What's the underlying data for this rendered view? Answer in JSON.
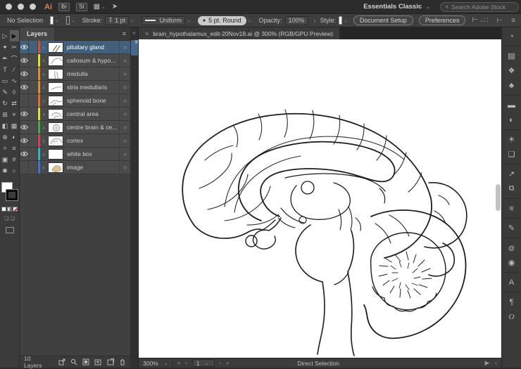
{
  "ui": {
    "logo_color": "#dd8454",
    "selection_color": "#41607c"
  },
  "titlebar": {
    "logo": "Ai",
    "bridge_button": "Br",
    "stock_button": "St",
    "workspace": "Essentials Classic",
    "search_placeholder": "Search Adobe Stock"
  },
  "controls": {
    "no_selection": "No Selection",
    "stroke_label": "Stroke:",
    "stroke_value": "1 pt",
    "width_profile": "Uniform",
    "brush_dot": "●",
    "brush": "5 pt. Round",
    "opacity_label": "Opacity:",
    "opacity_value": "100%",
    "more_separator": "›",
    "style_label": "Style:",
    "document_setup": "Document Setup",
    "preferences": "Preferences"
  },
  "doc_tab": {
    "close": "×",
    "title": "brain_hypothalamus_edit-20Nov18.ai @ 300% (RGB/GPU Preview)"
  },
  "layers": {
    "title": "Layers",
    "footer_count": "10 Layers",
    "items": [
      {
        "name": "pituitary gland",
        "color": "#d6512f"
      },
      {
        "name": "callosum & hypo...",
        "color": "#e3df33"
      },
      {
        "name": "medulla",
        "color": "#e08f2e"
      },
      {
        "name": "stria medullaris",
        "color": "#e08f2e"
      },
      {
        "name": "sphenoid bone",
        "color": "#de7429"
      },
      {
        "name": "central area",
        "color": "#e3df33"
      },
      {
        "name": "centre brain & ce...",
        "color": "#43b04c"
      },
      {
        "name": "cortex",
        "color": "#d64055"
      },
      {
        "name": "white box",
        "color": "#2fb7c6"
      },
      {
        "name": "image",
        "color": "#4472d8"
      }
    ]
  },
  "statusbar": {
    "zoom": "300%",
    "artboard": "1",
    "tool": "Direct Selection"
  },
  "icons": {
    "chevron": "⌄",
    "disclosure": "›",
    "target": "○",
    "menu": "≡",
    "collapse": "«",
    "nav_first": "«",
    "nav_prev": "‹",
    "nav_next": "›",
    "nav_last": "»",
    "play": "▶",
    "back": "‹",
    "search": "⌕",
    "rocket": "➤",
    "workspace_switcher": "▦",
    "grid": "∷",
    "arrange": "⊢",
    "list": "≡"
  },
  "tools": [
    "▷",
    "▶",
    "✦",
    "✂",
    "✒",
    "⌒",
    "T",
    "∕",
    "▭",
    "∿",
    "✎",
    "◊",
    "↻",
    "⇄",
    "⊞",
    "⌖",
    "◧",
    "▦",
    "⊕",
    "◐",
    "✧",
    "≡",
    "▣",
    "#",
    "✱",
    "○"
  ],
  "dock": [
    {
      "glyph": "◔"
    },
    {
      "glyph": "▤"
    },
    {
      "glyph": "❖"
    },
    {
      "glyph": "♣"
    },
    {
      "glyph": "▬"
    },
    {
      "glyph": "◐"
    },
    {
      "glyph": "☀"
    },
    {
      "glyph": "❑"
    },
    {
      "glyph": "↗"
    },
    {
      "glyph": "⧉"
    },
    {
      "glyph": "≡"
    },
    {
      "glyph": "✎"
    },
    {
      "glyph": "@"
    },
    {
      "glyph": "◉"
    },
    {
      "glyph": "A"
    },
    {
      "glyph": "¶"
    },
    {
      "glyph": "O"
    }
  ]
}
